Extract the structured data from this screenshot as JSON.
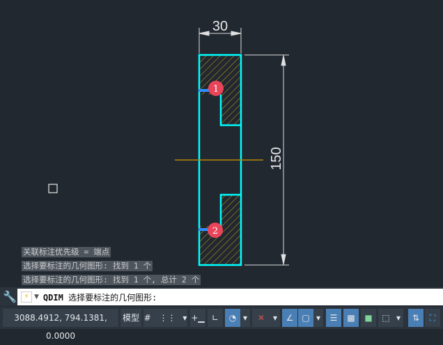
{
  "drawing": {
    "dim_width": "30",
    "dim_height": "150",
    "markers": [
      "1",
      "2"
    ],
    "colors": {
      "outline": "#00ffff",
      "hatch": "#d4a017",
      "center": "#b8860b",
      "dim": "#e0e0e0",
      "marker": "#e8455a"
    }
  },
  "history": [
    "关联标注优先级 = 端点",
    "选择要标注的几何图形: 找到 1 个",
    "选择要标注的几何图形: 找到 1 个, 总计 2 个"
  ],
  "command": {
    "name": "QDIM",
    "prompt": "选择要标注的几何图形:"
  },
  "status": {
    "coords": "3088.4912, 794.1381, 0.0000",
    "model": "模型",
    "grid": "#",
    "snap": "⋮⋮",
    "arrow": "▾"
  }
}
